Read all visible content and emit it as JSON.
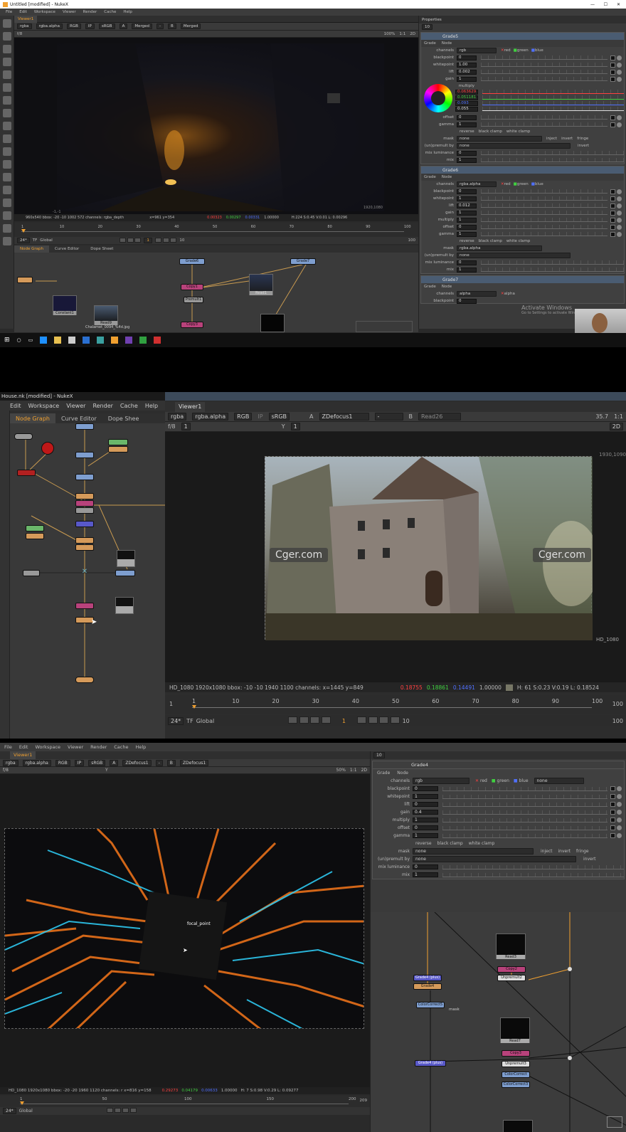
{
  "s1": {
    "window_title": "Untitled [modified] - NukeX",
    "menu": [
      "File",
      "Edit",
      "Workspace",
      "Viewer",
      "Render",
      "Cache",
      "Help"
    ],
    "viewer_tab": "Viewer1",
    "viewer_controls": [
      "rgba",
      "rgba.alpha",
      "RGB",
      "IP",
      "sRGB",
      "A",
      "Merged",
      "-",
      "B",
      "Merged"
    ],
    "frame_f": "f/8",
    "zoom": "100%",
    "ratio": "1:1",
    "mode": "2D",
    "res_corner": "1920,1080",
    "res_corner2": "-1,-1",
    "status_left": "960x540  bbox: -20 -10 1002 572 channels: rgba_depth",
    "status_xy": "x=961 y=354",
    "status_r": "0.00323",
    "status_g": "0.00297",
    "status_b": "0.00331",
    "status_a": "1.00000",
    "status_hsv": "H:224 S:0.45 V:0.01  L: 0.00296",
    "fps": "24*",
    "tf": "TF",
    "global": "Global",
    "frame_current": "1",
    "frame_step": "10",
    "frame_end": "100",
    "timeline_ticks": [
      "1",
      "10",
      "20",
      "30",
      "40",
      "50",
      "60",
      "70",
      "80",
      "90",
      "100"
    ],
    "graph_tabs": [
      "Node Graph",
      "Curve Editor",
      "Dope Sheet"
    ],
    "nodes": [
      "Grade6",
      "Grade7",
      "Copy1",
      "Premult1",
      "Read1",
      "Constant1",
      "Read9",
      "Copy3"
    ],
    "node_file": "Chalamet_0094_%4d.jpg",
    "props_title": "Properties",
    "props_count": "10",
    "grade_a": {
      "name": "Grade5",
      "tabs": [
        "Grade",
        "Node"
      ],
      "channels": "rgb",
      "chk": [
        "red",
        "green",
        "blue"
      ],
      "rows": [
        {
          "label": "blackpoint",
          "value": "0"
        },
        {
          "label": "whitepoint",
          "value": "1.00"
        },
        {
          "label": "lift",
          "value": "0.002"
        },
        {
          "label": "gain",
          "value": "1"
        }
      ],
      "multiply_label": "multiply",
      "multiply_vals": [
        "0.063629",
        "0.051181",
        "0.093",
        "0.055"
      ],
      "rows2": [
        {
          "label": "offset",
          "value": "0"
        },
        {
          "label": "gamma",
          "value": "1"
        }
      ],
      "checks": [
        "reverse",
        "black clamp",
        "white clamp"
      ],
      "mask_label": "mask",
      "mask_val": "none",
      "mask_opts": [
        "inject",
        "invert",
        "fringe"
      ],
      "unpremult_label": "(un)premult by",
      "unpremult_val": "none",
      "invert": "invert",
      "mixlum_label": "mix luminance",
      "mixlum_val": "0",
      "mix_label": "mix",
      "mix_val": "1"
    },
    "grade_b": {
      "name": "Grade6",
      "channels": "rgba.alpha",
      "rows": [
        {
          "label": "blackpoint",
          "value": "0"
        },
        {
          "label": "whitepoint",
          "value": "1"
        },
        {
          "label": "lift",
          "value": "0.012"
        },
        {
          "label": "gain",
          "value": "1"
        },
        {
          "label": "multiply",
          "value": "1"
        },
        {
          "label": "offset",
          "value": "0"
        },
        {
          "label": "gamma",
          "value": "1"
        }
      ],
      "mask_val": "rgba.alpha",
      "unpremult_val": "none",
      "mixlum_val": "0",
      "mix_val": "1"
    },
    "grade_c": {
      "name": "Grade7",
      "channels": "alpha",
      "chk": "alpha",
      "rows": [
        {
          "label": "blackpoint",
          "value": "0"
        }
      ]
    },
    "activate": "Activate Windows",
    "activate_sub": "Go to Settings to activate Windows."
  },
  "s2": {
    "window_title": "House.nk [modified] - NukeX",
    "menu": [
      "Edit",
      "Workspace",
      "Viewer",
      "Render",
      "Cache",
      "Help"
    ],
    "graph_tabs": [
      "Node Graph",
      "Curve Editor",
      "Dope Shee"
    ],
    "viewer_tab": "Viewer1",
    "viewer_controls": [
      "rgba",
      "rgba.alpha",
      "RGB",
      "IP",
      "sRGB"
    ],
    "a_input": "ZDefocus1",
    "b_input": "Read26",
    "dash": "-",
    "frame_f": "f/8",
    "frame_1": "1",
    "y_label": "Y",
    "y_val": "1",
    "fps_val": "35.7",
    "ratio": "1:1",
    "mode": "2D",
    "res_corner": "1930,1090",
    "res_label": "HD_1080",
    "watermark": "Cger.com",
    "status_left": "HD_1080 1920x1080  bbox: -10 -10 1940 1100 channels:  x=1445 y=849",
    "status_r": "0.18755",
    "status_g": "0.18861",
    "status_b": "0.14491",
    "status_a": "1.00000",
    "status_hsv": "H: 61 S:0.23 V:0.19  L: 0.18524",
    "fps": "24*",
    "tf": "TF",
    "global": "Global",
    "frame_current": "1",
    "frame_step": "10",
    "frame_end": "100",
    "timeline_ticks": [
      "1",
      "10",
      "20",
      "30",
      "40",
      "50",
      "60",
      "70",
      "80",
      "90",
      "100"
    ]
  },
  "s3": {
    "menu": [
      "File",
      "Edit",
      "Workspace",
      "Viewer",
      "Render",
      "Cache",
      "Help"
    ],
    "viewer_tab": "Viewer1",
    "viewer_controls": [
      "rgba",
      "rgba.alpha",
      "RGB",
      "IP",
      "sRGB",
      "A",
      "ZDefocus1",
      "-",
      "B",
      "ZDefocus1"
    ],
    "zoom": "50%",
    "ratio": "1:1",
    "frame_f": "f/8",
    "y_label": "Y",
    "mode": "2D",
    "focal": "focal_point",
    "status_left": "HD_1080 1920x1080  bbox: -20 -20 1960 1120 channels: r  x=816 y=158",
    "status_r": "0.29273",
    "status_g": "0.04179",
    "status_b": "0.00633",
    "status_a": "1.00000",
    "status_hsv": "H:  7 S:0.98 V:0.29  L: 0.09277",
    "timeline_ticks": [
      "1",
      "50",
      "100",
      "150",
      "200"
    ],
    "frame_end": "209",
    "fps": "24*",
    "global": "Global",
    "props_count": "10",
    "grade": {
      "name": "Grade4",
      "tabs": [
        "Grade",
        "Node"
      ],
      "channels": "rgb",
      "chk": [
        "red",
        "green",
        "blue"
      ],
      "chk_none": "none",
      "rows": [
        {
          "label": "blackpoint",
          "value": "0"
        },
        {
          "label": "whitepoint",
          "value": "1"
        },
        {
          "label": "lift",
          "value": "0"
        },
        {
          "label": "gain",
          "value": "0.4"
        },
        {
          "label": "multiply",
          "value": "1"
        },
        {
          "label": "offset",
          "value": "0"
        },
        {
          "label": "gamma",
          "value": "1"
        }
      ],
      "checks": [
        "reverse",
        "black clamp",
        "white clamp"
      ],
      "mask_label": "mask",
      "mask_val": "none",
      "mask_opts": [
        "inject",
        "invert",
        "fringe"
      ],
      "unpremult_label": "(un)premult by",
      "unpremult_val": "none",
      "invert": "invert",
      "mixlum_label": "mix luminance",
      "mixlum_val": "0",
      "mix_label": "mix",
      "mix_val": "1"
    },
    "nodes": [
      "Read3",
      "Copy2",
      "Unpremult2",
      "Grade4",
      "ColorCorrect5",
      "Read7",
      "Copy3",
      "Unpremult3",
      "ColorCorrect",
      "ColorCorrect3",
      "Grade4 (plus)"
    ],
    "mask_link": "mask"
  },
  "colors": {
    "accent": "#f0a030",
    "red": "#ff4040",
    "green": "#40d040",
    "blue": "#5070ff"
  }
}
